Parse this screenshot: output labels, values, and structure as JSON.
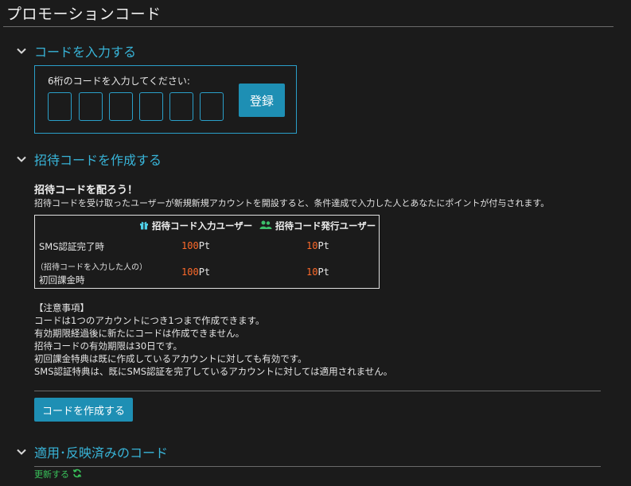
{
  "page": {
    "title": "プロモーションコード"
  },
  "section_enter": {
    "heading": "コードを入力する",
    "prompt": "6桁のコードを入力してください:",
    "digits": [
      "",
      "",
      "",
      "",
      "",
      ""
    ],
    "register_label": "登録"
  },
  "section_create": {
    "heading": "招待コードを作成する",
    "invite_title": "招待コードを配ろう！",
    "invite_desc": "招待コードを受け取ったユーザーが新規新規アカウントを開設すると、条件達成で入力した人とあなたにポイントが付与されます。",
    "table": {
      "col_input_user": "招待コード入力ユーザー",
      "col_issuer_user": "招待コード発行ユーザー",
      "rows": [
        {
          "label": "SMS認証完了時",
          "sublabel": "",
          "input_num": "100",
          "input_unit": "Pt",
          "issuer_num": "10",
          "issuer_unit": "Pt"
        },
        {
          "label": "初回課金時",
          "sublabel": "（招待コードを入力した人の）",
          "input_num": "100",
          "input_unit": "Pt",
          "issuer_num": "10",
          "issuer_unit": "Pt"
        }
      ]
    },
    "notes": [
      "【注意事項】",
      "コードは1つのアカウントにつき1つまで作成できます。",
      "有効期限経過後に新たにコードは作成できません。",
      "招待コードの有効期限は30日です。",
      "初回課金特典は既に作成しているアカウントに対しても有効です。",
      "SMS認証特典は、既にSMS認証を完了しているアカウントに対しては適用されません。"
    ],
    "create_label": "コードを作成する"
  },
  "section_applied": {
    "heading": "適用･反映済みのコード",
    "refresh_label": "更新する"
  },
  "colors": {
    "accent": "#38b4d8",
    "button": "#1e8fb4",
    "points": "#ff6a2a",
    "refresh": "#39c05a",
    "gift_icon": "#4fd0e8",
    "users_icon": "#3cc06a"
  },
  "icons": [
    "chevron-down-icon",
    "gift-icon",
    "users-icon",
    "refresh-icon"
  ]
}
